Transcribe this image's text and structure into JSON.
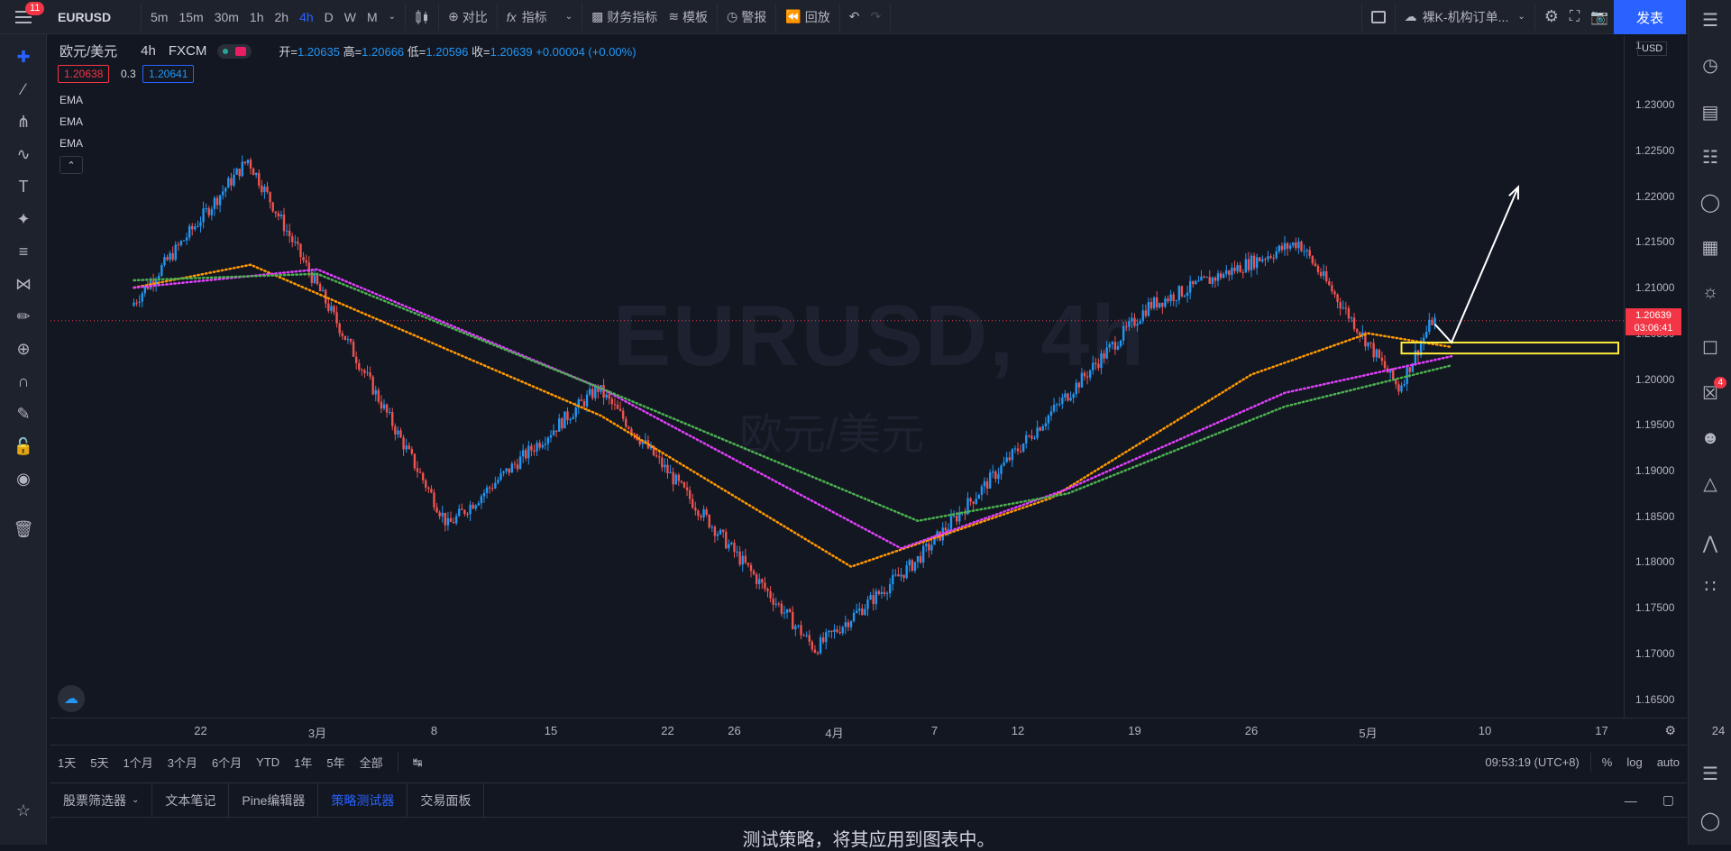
{
  "topbar": {
    "notification_count": "11",
    "symbol": "EURUSD",
    "timeframes": [
      "5m",
      "15m",
      "30m",
      "1h",
      "2h",
      "4h",
      "D",
      "W",
      "M"
    ],
    "active_timeframe": "4h",
    "compare_label": "对比",
    "indicators_label": "指标",
    "financials_label": "财务指标",
    "templates_label": "模板",
    "alerts_label": "警报",
    "replay_label": "回放",
    "layout_name": "裸K-机构订单...",
    "publish_label": "发表"
  },
  "legend": {
    "title": "欧元/美元",
    "interval": "4h",
    "exchange": "FXCM",
    "open_label": "开=",
    "open": "1.20635",
    "high_label": "高=",
    "high": "1.20666",
    "low_label": "低=",
    "low": "1.20596",
    "close_label": "收=",
    "close": "1.20639",
    "change": "+0.00004 (+0.00%)",
    "sell_price": "1.20638",
    "spread": "0.3",
    "buy_price": "1.20641",
    "indicators": [
      "EMA",
      "EMA",
      "EMA"
    ]
  },
  "watermark": {
    "symbol": "EURUSD, 4h",
    "name": "欧元/美元"
  },
  "price_axis": {
    "currency": "USD",
    "ticks": [
      "1.23000",
      "1.22500",
      "1.22000",
      "1.21500",
      "1.21000",
      "1.20500",
      "1.20000",
      "1.19500",
      "1.19000",
      "1.18500",
      "1.18000",
      "1.17500",
      "1.17000",
      "1.16500"
    ],
    "top_partial": "1.",
    "current_price": "1.20639",
    "countdown": "03:06:41"
  },
  "time_axis": {
    "ticks": [
      "22",
      "3月",
      "8",
      "15",
      "22",
      "26",
      "4月",
      "7",
      "12",
      "19",
      "26",
      "5月",
      "10",
      "17",
      "24"
    ]
  },
  "range_bar": {
    "ranges": [
      "1天",
      "5天",
      "1个月",
      "3个月",
      "6个月",
      "YTD",
      "1年",
      "5年",
      "全部"
    ],
    "clock": "09:53:19 (UTC+8)",
    "percent": "%",
    "log": "log",
    "auto": "auto"
  },
  "bottom_panel": {
    "tabs": [
      "股票筛选器",
      "文本笔记",
      "Pine编辑器",
      "策略测试器",
      "交易面板"
    ],
    "active_tab": "策略测试器",
    "message": "测试策略，将其应用到图表中。"
  },
  "right_panel": {
    "chat_badge": "4"
  },
  "colors": {
    "bull": "#2196f3",
    "bear": "#ef5350",
    "ema_fast": "#ff9800",
    "ema_mid": "#e040fb",
    "ema_slow": "#4caf50",
    "zone": "#ffeb3b",
    "accent": "#2962ff"
  },
  "chart_data": {
    "type": "candlestick",
    "symbol": "EURUSD",
    "interval": "4h",
    "ylim": [
      1.163,
      1.2375
    ],
    "key_points": [
      {
        "date": "2021-02-18",
        "price": 1.208
      },
      {
        "date": "2021-02-25",
        "price": 1.224
      },
      {
        "date": "2021-03-09",
        "price": 1.184
      },
      {
        "date": "2021-03-18",
        "price": 1.199
      },
      {
        "date": "2021-03-31",
        "price": 1.1705
      },
      {
        "date": "2021-04-06",
        "price": 1.18
      },
      {
        "date": "2021-04-20",
        "price": 1.208
      },
      {
        "date": "2021-04-29",
        "price": 1.215
      },
      {
        "date": "2021-05-05",
        "price": 1.199
      },
      {
        "date": "2021-05-07",
        "price": 1.2064
      }
    ],
    "ema_lines": [
      {
        "color": "ema_fast",
        "points": [
          {
            "date": "2021-02-18",
            "price": 1.21
          },
          {
            "date": "2021-02-25",
            "price": 1.2125
          },
          {
            "date": "2021-03-18",
            "price": 1.196
          },
          {
            "date": "2021-04-02",
            "price": 1.1795
          },
          {
            "date": "2021-04-14",
            "price": 1.187
          },
          {
            "date": "2021-04-26",
            "price": 1.2005
          },
          {
            "date": "2021-05-03",
            "price": 1.205
          },
          {
            "date": "2021-05-08",
            "price": 1.2035
          }
        ]
      },
      {
        "color": "ema_mid",
        "points": [
          {
            "date": "2021-02-18",
            "price": 1.21
          },
          {
            "date": "2021-03-01",
            "price": 1.212
          },
          {
            "date": "2021-03-18",
            "price": 1.199
          },
          {
            "date": "2021-04-05",
            "price": 1.1815
          },
          {
            "date": "2021-04-15",
            "price": 1.188
          },
          {
            "date": "2021-04-28",
            "price": 1.1985
          },
          {
            "date": "2021-05-08",
            "price": 1.2025
          }
        ]
      },
      {
        "color": "ema_slow",
        "points": [
          {
            "date": "2021-02-18",
            "price": 1.2108
          },
          {
            "date": "2021-03-01",
            "price": 1.2115
          },
          {
            "date": "2021-03-18",
            "price": 1.199
          },
          {
            "date": "2021-04-06",
            "price": 1.1845
          },
          {
            "date": "2021-04-15",
            "price": 1.1875
          },
          {
            "date": "2021-04-28",
            "price": 1.197
          },
          {
            "date": "2021-05-08",
            "price": 1.2015
          }
        ]
      }
    ],
    "drawings": [
      {
        "type": "rectangle",
        "from_date": "2021-05-05",
        "to_date": "2021-05-18",
        "price_top": 1.204,
        "price_bottom": 1.2028
      },
      {
        "type": "arrow",
        "points": [
          {
            "date": "2021-05-07",
            "price": 1.206
          },
          {
            "date": "2021-05-08",
            "price": 1.204
          },
          {
            "date": "2021-05-12",
            "price": 1.221
          }
        ]
      }
    ]
  }
}
